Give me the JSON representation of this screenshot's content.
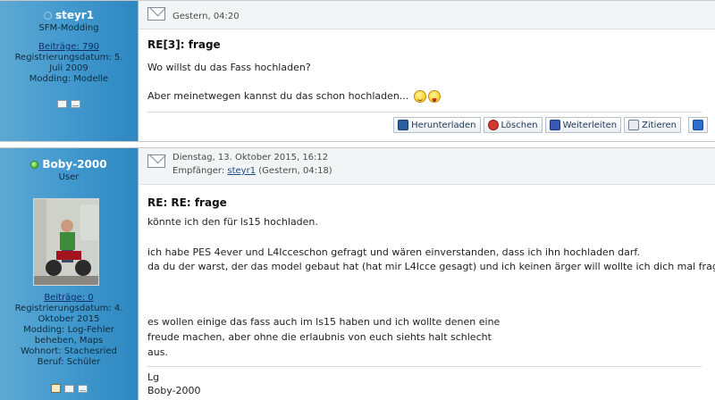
{
  "post1": {
    "user": {
      "name": "steyr1",
      "rank": "SFM-Modding",
      "posts": "Beiträge: 790",
      "registered": "Registrierungsdatum: 5. Juli 2009",
      "modding": "Modding: Modelle"
    },
    "date": "Gestern, 04:20",
    "subject": "RE[3]: frage",
    "line1": "Wo willst du das Fass hochladen?",
    "line2": "Aber meinetwegen kannst du das schon hochladen...",
    "buttons": {
      "download": "Herunterladen",
      "delete": "Löschen",
      "forward": "Weiterleiten",
      "quote": "Zitieren"
    }
  },
  "post2": {
    "user": {
      "name": "Boby-2000",
      "rank": "User",
      "posts": "Beiträge: 0",
      "registered": "Registrierungsdatum: 4. Oktober 2015",
      "modding": "Modding: Log-Fehler beheben, Maps",
      "wohnort": "Wohnort: Stachesried",
      "beruf": "Beruf: Schüler"
    },
    "date": "Dienstag, 13. Oktober 2015, 16:12",
    "recipient_label": "Empfänger:",
    "recipient_name": "steyr1",
    "recipient_time": "(Gestern, 04:18)",
    "subject": "RE: RE: frage",
    "body1": "könnte ich den für ls15 hochladen.",
    "body2": "ich habe PES 4ever und L4Iccеschon gefragt und wären einverstanden, dass ich ihn hochladen darf.",
    "body3": "da du der warst, der das model gebaut hat (hat mir L4Icce gesagt) und ich keinen ärger will wollte ich dich mal fragen.",
    "body4": "es wollen einige das fass auch im ls15 haben und ich wollte denen eine",
    "body5": "freude machen, aber ohne die erlaubnis von euch siehts halt schlecht",
    "body6": "aus.",
    "sig1": "Lg",
    "sig2": "Boby-2000"
  },
  "icons": [
    "envelope-icon",
    "profile-card-icon",
    "mail-icon",
    "home-icon",
    "save-icon",
    "delete-icon",
    "forward-icon",
    "quote-icon",
    "scroll-up-icon",
    "online-status-icon",
    "offline-status-icon",
    "smiley-icon",
    "tongue-smiley-icon"
  ]
}
